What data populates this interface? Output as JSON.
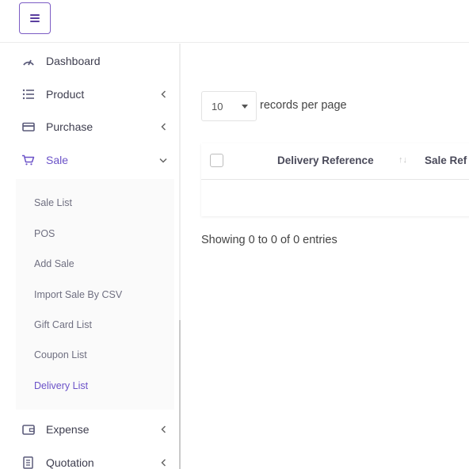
{
  "topbar": {
    "menu_toggle_icon": "hamburger-icon"
  },
  "sidebar": {
    "items": [
      {
        "label": "Dashboard",
        "icon": "dashboard-gauge-icon",
        "has_caret": false
      },
      {
        "label": "Product",
        "icon": "list-icon",
        "has_caret": true
      },
      {
        "label": "Purchase",
        "icon": "card-icon",
        "has_caret": true
      },
      {
        "label": "Sale",
        "icon": "cart-icon",
        "has_caret": true,
        "expanded": true
      },
      {
        "label": "Expense",
        "icon": "wallet-icon",
        "has_caret": true
      },
      {
        "label": "Quotation",
        "icon": "document-icon",
        "has_caret": true
      }
    ],
    "sale_submenu": [
      "Sale List",
      "POS",
      "Add Sale",
      "Import Sale By CSV",
      "Gift Card List",
      "Coupon List",
      "Delivery List"
    ],
    "active_color": "#6b52c8"
  },
  "main": {
    "per_page": {
      "value": "10",
      "label": "records per page"
    },
    "table": {
      "columns": [
        "Delivery Reference",
        "Sale Ref"
      ],
      "rows": []
    },
    "info": "Showing 0 to 0 of 0 entries"
  }
}
